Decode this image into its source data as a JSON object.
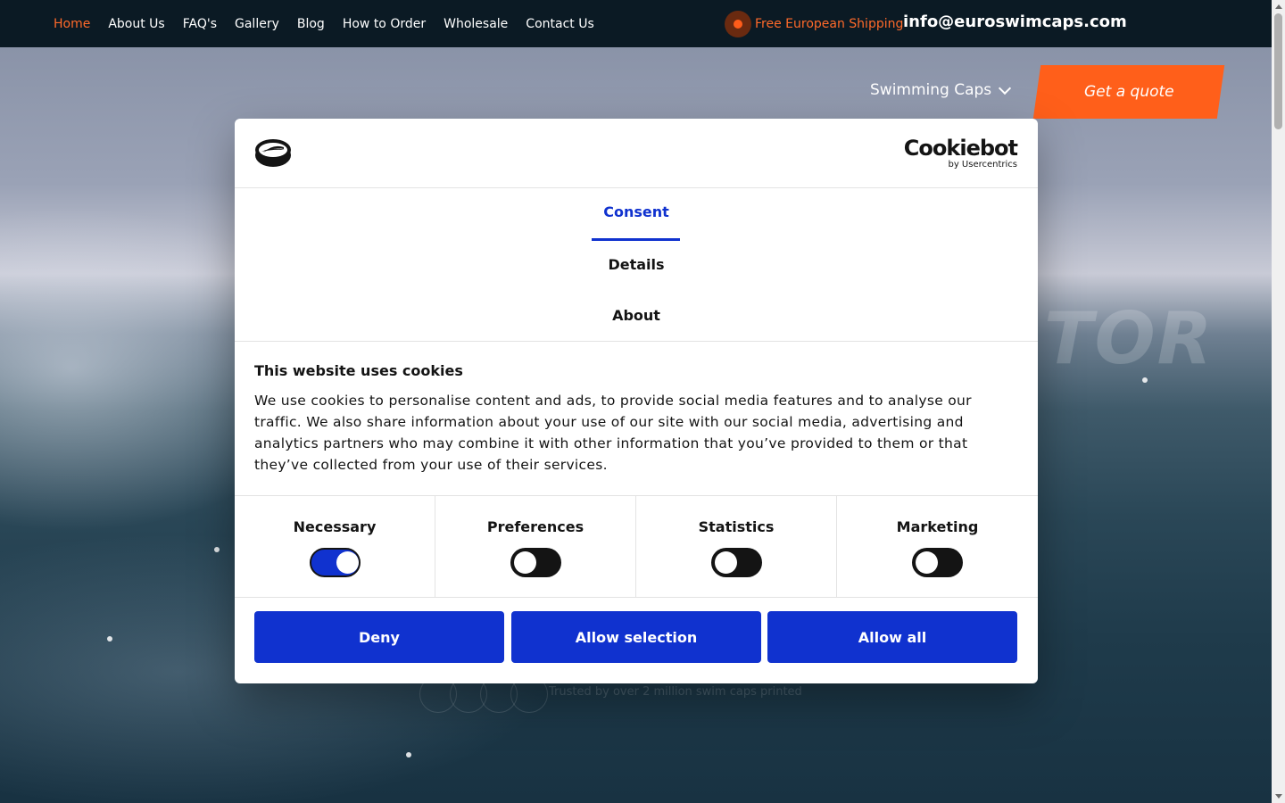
{
  "topbar": {
    "nav": [
      {
        "label": "Home",
        "active": true
      },
      {
        "label": "About Us"
      },
      {
        "label": "FAQ's"
      },
      {
        "label": "Gallery"
      },
      {
        "label": "Blog"
      },
      {
        "label": "How to Order"
      },
      {
        "label": "Wholesale"
      },
      {
        "label": "Contact Us"
      }
    ],
    "shipping_text": "Free European Shipping",
    "email": "info@euroswimcaps.com"
  },
  "hero": {
    "menu_label": "Swimming Caps",
    "quote_button": "Get a quote",
    "watermark_text": "TOR",
    "faint_text": "Trusted by over 2 million swim caps printed"
  },
  "dialog": {
    "brand": "Cookiebot",
    "brand_sub": "by Usercentrics",
    "tabs": [
      "Consent",
      "Details",
      "About"
    ],
    "active_tab": "Consent",
    "heading": "This website uses cookies",
    "body": "We use cookies to personalise content and ads, to provide social media features and to analyse our traffic. We also share information about your use of our site with our social media, advertising and analytics partners who may combine it with other information that you’ve provided to them or that they’ve collected from your use of their services.",
    "toggles": [
      {
        "label": "Necessary",
        "checked": true
      },
      {
        "label": "Preferences",
        "checked": false
      },
      {
        "label": "Statistics",
        "checked": false
      },
      {
        "label": "Marketing",
        "checked": false
      }
    ],
    "buttons": {
      "deny": "Deny",
      "allow_selection": "Allow selection",
      "allow_all": "Allow all"
    }
  },
  "colors": {
    "accent_orange": "#ff5f1a",
    "cookiebot_blue": "#1032cf",
    "topbar_bg": "#0b1a24"
  }
}
